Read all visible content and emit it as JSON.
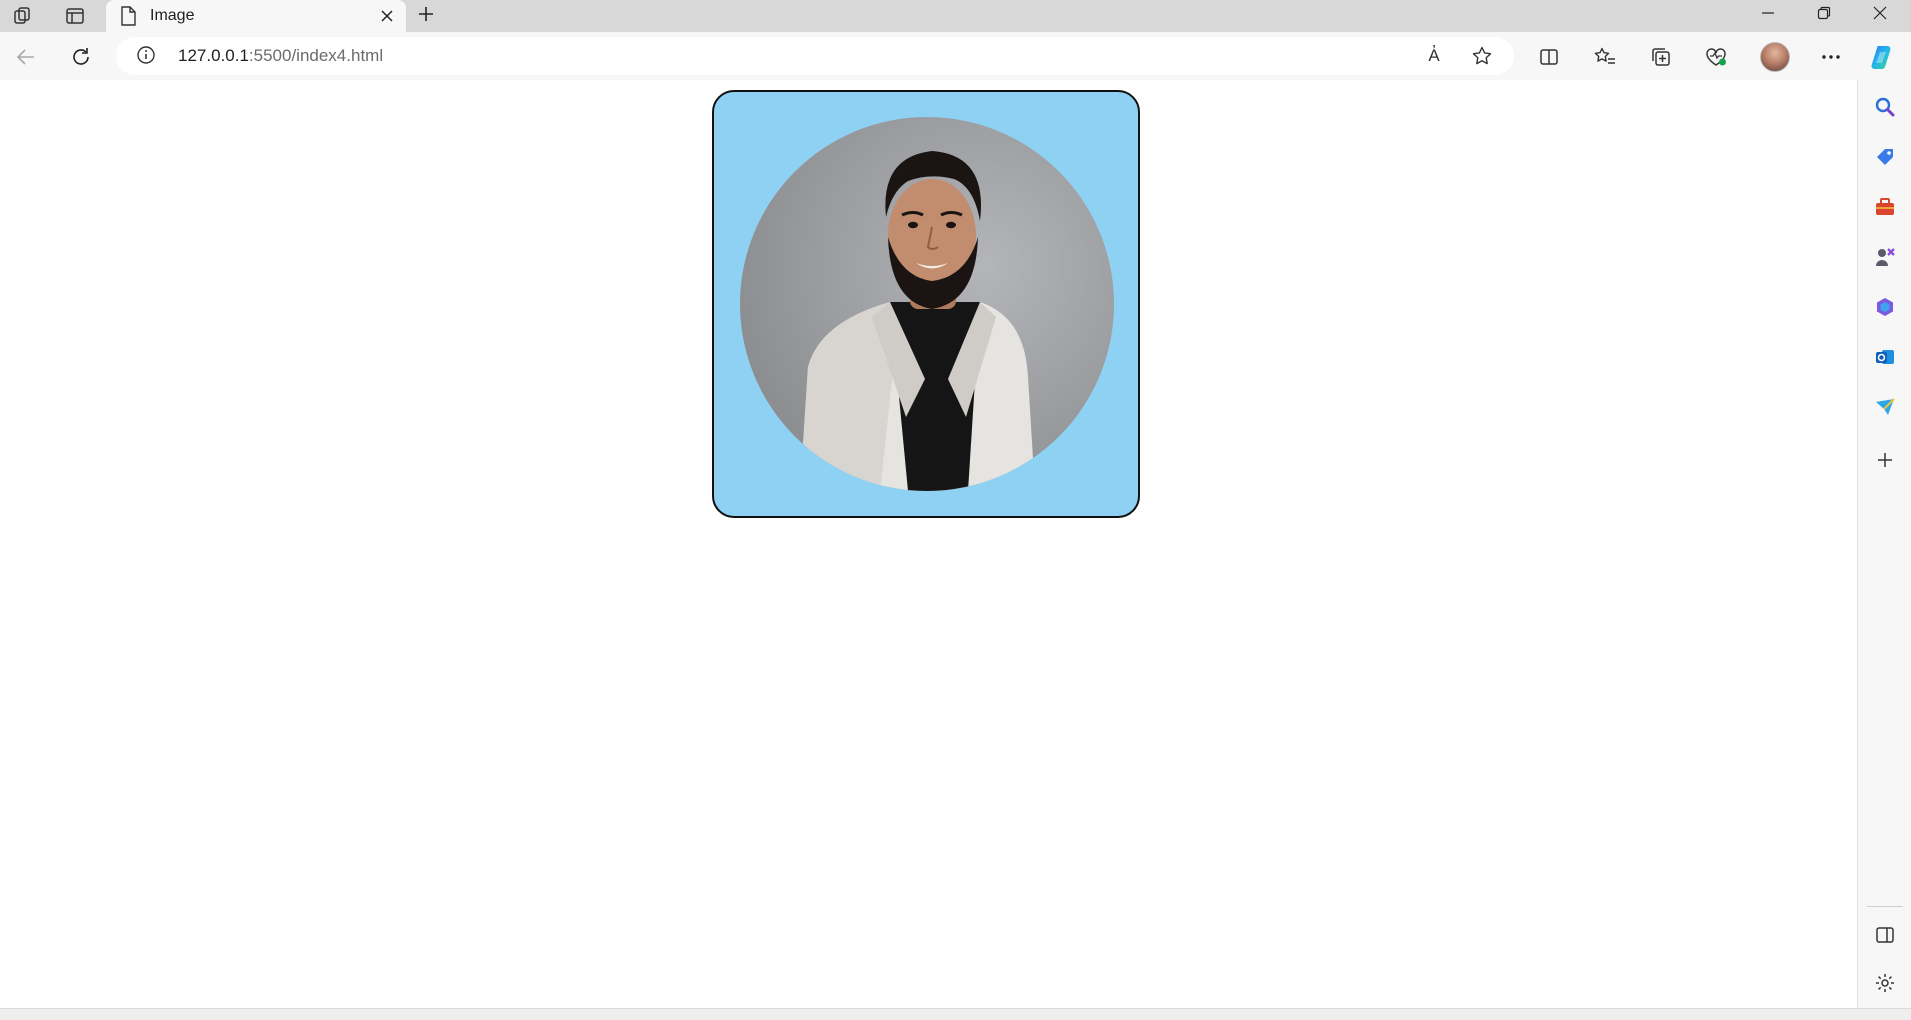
{
  "browser": {
    "tab": {
      "title": "Image"
    },
    "address": {
      "url_host": "127.0.0.1",
      "url_rest": ":5500/index4.html"
    },
    "read_aloud_label": "A҆"
  },
  "page": {
    "card_color": "#8fd1f2",
    "border_color": "#111111"
  },
  "icons": {
    "tabbar": [
      "workspaces-icon",
      "vertical-tabs-icon",
      "page-icon",
      "close-icon",
      "plus-icon"
    ],
    "window": [
      "minimize-icon",
      "restore-icon",
      "close-window-icon"
    ],
    "toolbar": [
      "back-icon",
      "refresh-icon",
      "info-icon",
      "read-aloud-icon",
      "favorite-star-icon",
      "split-screen-icon",
      "favorites-icon",
      "collections-icon",
      "browser-essentials-icon",
      "profile-avatar",
      "more-icon",
      "copilot-icon"
    ],
    "sidebar": [
      "search-icon",
      "shopping-icon",
      "tools-icon",
      "games-icon",
      "office-icon",
      "outlook-icon",
      "send-icon",
      "add-icon",
      "sidebar-toggle-icon",
      "settings-icon"
    ]
  }
}
